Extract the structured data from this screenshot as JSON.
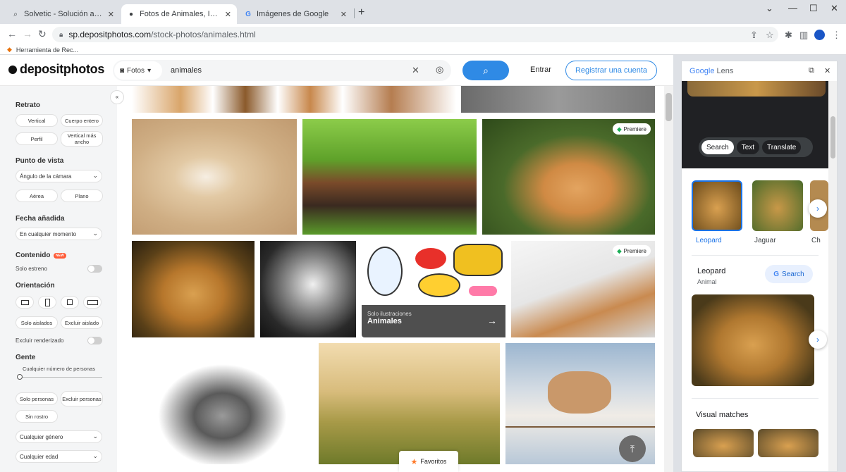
{
  "browser": {
    "tabs": [
      {
        "title": "Solvetic - Solución a los problem",
        "active": false
      },
      {
        "title": "Fotos de Animales, Imágenes de",
        "active": true
      },
      {
        "title": "Imágenes de Google",
        "active": false
      }
    ],
    "url_domain": "sp.depositphotos.com",
    "url_path": "/stock-photos/animales.html",
    "bookmark": "Herramienta de Rec..."
  },
  "site": {
    "logo": "depositphotos",
    "search_type": "Fotos",
    "query": "animales",
    "login": "Entrar",
    "register": "Registrar una cuenta"
  },
  "filters": {
    "retrato_title": "Retrato",
    "retrato": [
      "Vertical",
      "Cuerpo entero",
      "Perfil",
      "Vertical más ancho"
    ],
    "punto_title": "Punto de vista",
    "punto_select": "Ángulo de la cámara",
    "punto": [
      "Aérea",
      "Plano"
    ],
    "fecha_title": "Fecha añadida",
    "fecha_select": "En cualquier momento",
    "contenido_title": "Contenido",
    "new_badge": "NEW",
    "solo_estreno": "Solo estreno",
    "orientacion_title": "Orientación",
    "aislado": [
      "Solo aislados",
      "Excluir aislado"
    ],
    "excluir_renderizado": "Excluir renderizado",
    "gente_title": "Gente",
    "personas_label": "Cualquier número de personas",
    "gente": [
      "Solo personas",
      "Excluir personas",
      "Sin rostro"
    ],
    "genero": "Cualquier género",
    "edad": "Cualquier edad"
  },
  "results": {
    "premiere": "Premiere",
    "illus_sub": "Solo ilustraciones",
    "illus_title": "Animales",
    "favoritos": "Favoritos"
  },
  "lens": {
    "title_g": "Google",
    "title_l": "Lens",
    "segments": [
      "Search",
      "Text",
      "Translate"
    ],
    "thumbs": [
      "Leopard",
      "Jaguar",
      "Ch"
    ],
    "entity": "Leopard",
    "entity_type": "Animal",
    "search_btn": "Search",
    "visual_matches": "Visual matches"
  },
  "colors": {
    "accent": "#2f8ae5",
    "lens_blue": "#1a73e8",
    "premiere_green": "#1aae55"
  }
}
